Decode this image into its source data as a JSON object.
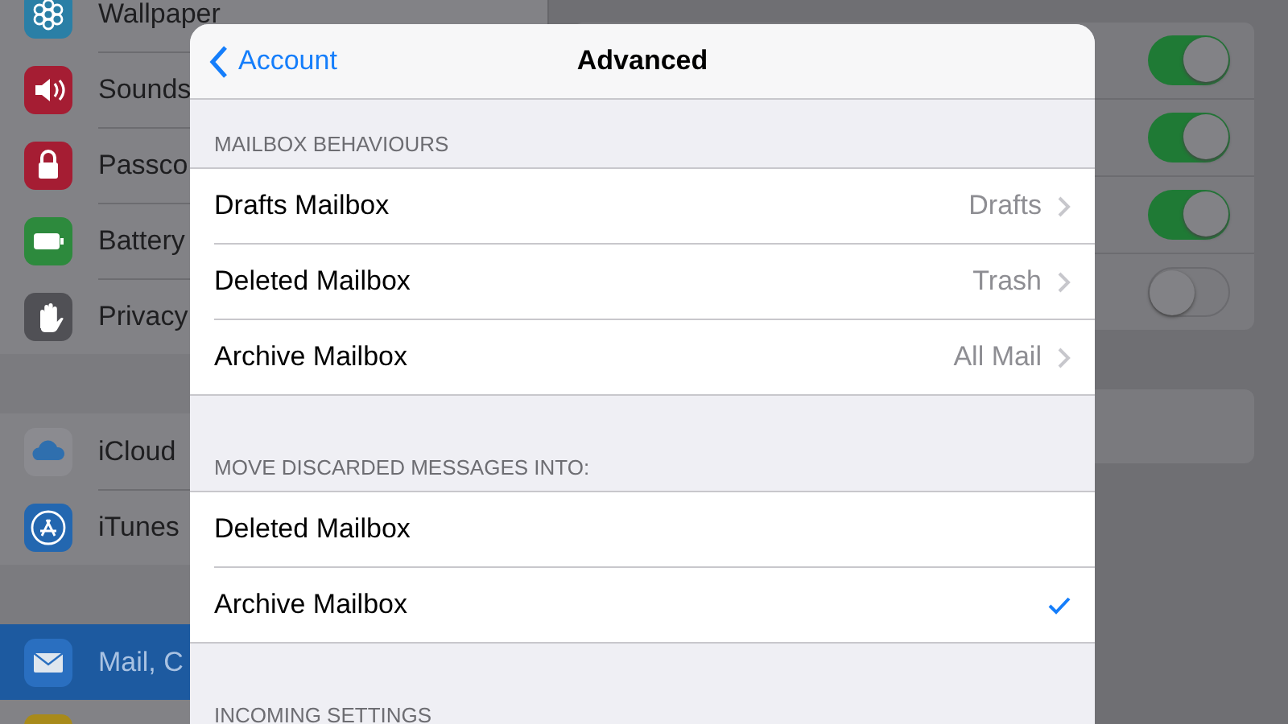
{
  "sidebar": {
    "groups": [
      {
        "items": [
          {
            "label": "Wallpaper",
            "selected": false
          },
          {
            "label": "Sounds",
            "selected": false
          },
          {
            "label": "Passco",
            "selected": false
          },
          {
            "label": "Battery",
            "selected": false
          },
          {
            "label": "Privacy",
            "selected": false
          }
        ]
      },
      {
        "items": [
          {
            "label": "iCloud",
            "selected": false
          },
          {
            "label": "iTunes",
            "selected": false
          }
        ]
      },
      {
        "items": [
          {
            "label": "Mail, C",
            "selected": true
          }
        ]
      }
    ]
  },
  "detail": {
    "switches": [
      {
        "on": true
      },
      {
        "on": true
      },
      {
        "on": true
      },
      {
        "on": false
      }
    ]
  },
  "sheet": {
    "back": "Account",
    "title": "Advanced",
    "sections": [
      {
        "header": "MAILBOX BEHAVIOURS",
        "rows": [
          {
            "kind": "link",
            "label": "Drafts Mailbox",
            "value": "Drafts"
          },
          {
            "kind": "link",
            "label": "Deleted Mailbox",
            "value": "Trash"
          },
          {
            "kind": "link",
            "label": "Archive Mailbox",
            "value": "All Mail"
          }
        ]
      },
      {
        "header": "MOVE DISCARDED MESSAGES INTO:",
        "rows": [
          {
            "kind": "choice",
            "label": "Deleted Mailbox",
            "checked": false
          },
          {
            "kind": "choice",
            "label": "Archive Mailbox",
            "checked": true
          }
        ]
      },
      {
        "header": "INCOMING SETTINGS"
      }
    ]
  }
}
